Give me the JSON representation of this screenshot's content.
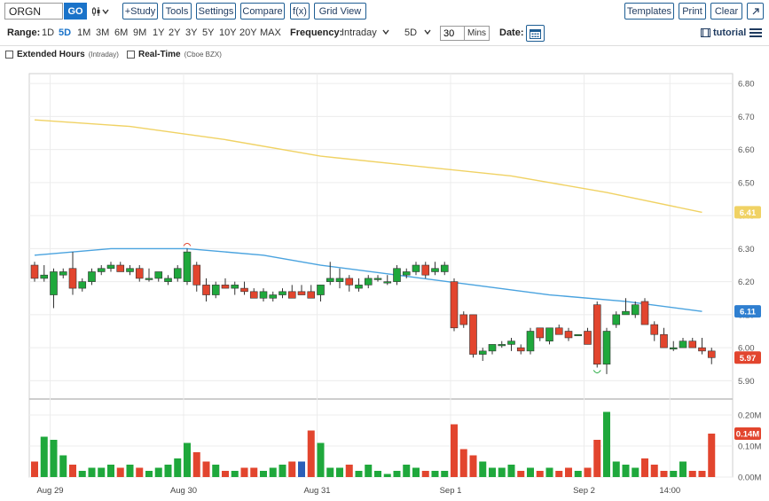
{
  "toolbar": {
    "symbol": "ORGN",
    "go_label": "GO",
    "chart_type_icon": "candlestick-icon",
    "buttons_left": [
      "+Study",
      "Tools",
      "Settings",
      "Compare",
      "f(x)",
      "Grid View"
    ],
    "buttons_right": [
      "Templates",
      "Print",
      "Clear"
    ],
    "expand_icon": "expand-icon"
  },
  "rangebar": {
    "range_label": "Range:",
    "ranges": [
      "1D",
      "5D",
      "1M",
      "3M",
      "6M",
      "9M",
      "1Y",
      "2Y",
      "3Y",
      "5Y",
      "10Y",
      "20Y",
      "MAX"
    ],
    "active_range": "5D",
    "frequency_label": "Frequency:",
    "frequency_value": "Intraday",
    "period_value": "5D",
    "minutes_value": "30",
    "minutes_unit": "Mins",
    "date_label": "Date:",
    "tutorial_label": "tutorial"
  },
  "options": {
    "extended_label": "Extended Hours",
    "extended_sub": "(Intraday)",
    "realtime_label": "Real-Time",
    "realtime_sub": "(Cboe BZX)"
  },
  "colors": {
    "up": "#1fa83c",
    "down": "#e2452e",
    "ma_fast": "#4aa3df",
    "ma_slow": "#f0d264",
    "vol_blue": "#2b5fb8"
  },
  "chart_data": {
    "type": "candlestick",
    "price_ylim": [
      5.85,
      6.83
    ],
    "price_ticks": [
      "6.80",
      "6.70",
      "6.60",
      "6.50",
      "6.40",
      "6.30",
      "6.20",
      "6.10",
      "6.00",
      "5.90"
    ],
    "volume_ylim": [
      0,
      0.24
    ],
    "volume_ticks": [
      "0.20M",
      "0.10M",
      "0.00M"
    ],
    "x_labels": [
      "Aug 29",
      "Aug 30",
      "Aug 31",
      "Sep 1",
      "Sep 2",
      "14:00"
    ],
    "badges": {
      "ma_slow": {
        "label": "6.41",
        "value": 6.41
      },
      "ma_fast": {
        "label": "6.11",
        "value": 6.11
      },
      "last": {
        "label": "5.97",
        "value": 5.97
      },
      "volume": {
        "label": "0.14M",
        "value": 0.14
      }
    },
    "candles": [
      {
        "o": 6.25,
        "h": 6.26,
        "l": 6.2,
        "c": 6.21
      },
      {
        "o": 6.21,
        "h": 6.25,
        "l": 6.2,
        "c": 6.22
      },
      {
        "o": 6.16,
        "h": 6.24,
        "l": 6.12,
        "c": 6.23
      },
      {
        "o": 6.22,
        "h": 6.24,
        "l": 6.21,
        "c": 6.23
      },
      {
        "o": 6.24,
        "h": 6.29,
        "l": 6.16,
        "c": 6.18
      },
      {
        "o": 6.18,
        "h": 6.21,
        "l": 6.17,
        "c": 6.2
      },
      {
        "o": 6.2,
        "h": 6.24,
        "l": 6.19,
        "c": 6.23
      },
      {
        "o": 6.23,
        "h": 6.25,
        "l": 6.22,
        "c": 6.24
      },
      {
        "o": 6.24,
        "h": 6.26,
        "l": 6.23,
        "c": 6.25
      },
      {
        "o": 6.25,
        "h": 6.26,
        "l": 6.23,
        "c": 6.23
      },
      {
        "o": 6.23,
        "h": 6.25,
        "l": 6.22,
        "c": 6.24
      },
      {
        "o": 6.24,
        "h": 6.25,
        "l": 6.2,
        "c": 6.21
      },
      {
        "o": 6.21,
        "h": 6.24,
        "l": 6.2,
        "c": 6.21
      },
      {
        "o": 6.21,
        "h": 6.23,
        "l": 6.2,
        "c": 6.23
      },
      {
        "o": 6.2,
        "h": 6.22,
        "l": 6.19,
        "c": 6.21
      },
      {
        "o": 6.21,
        "h": 6.25,
        "l": 6.2,
        "c": 6.24
      },
      {
        "o": 6.2,
        "h": 6.3,
        "l": 6.19,
        "c": 6.29
      },
      {
        "o": 6.25,
        "h": 6.26,
        "l": 6.17,
        "c": 6.19
      },
      {
        "o": 6.19,
        "h": 6.21,
        "l": 6.14,
        "c": 6.16
      },
      {
        "o": 6.16,
        "h": 6.2,
        "l": 6.15,
        "c": 6.19
      },
      {
        "o": 6.19,
        "h": 6.21,
        "l": 6.18,
        "c": 6.18
      },
      {
        "o": 6.18,
        "h": 6.2,
        "l": 6.16,
        "c": 6.19
      },
      {
        "o": 6.18,
        "h": 6.2,
        "l": 6.16,
        "c": 6.17
      },
      {
        "o": 6.17,
        "h": 6.18,
        "l": 6.15,
        "c": 6.15
      },
      {
        "o": 6.15,
        "h": 6.18,
        "l": 6.14,
        "c": 6.17
      },
      {
        "o": 6.15,
        "h": 6.17,
        "l": 6.14,
        "c": 6.16
      },
      {
        "o": 6.16,
        "h": 6.18,
        "l": 6.15,
        "c": 6.17
      },
      {
        "o": 6.17,
        "h": 6.19,
        "l": 6.15,
        "c": 6.15
      },
      {
        "o": 6.17,
        "h": 6.19,
        "l": 6.16,
        "c": 6.16
      },
      {
        "o": 6.17,
        "h": 6.19,
        "l": 6.15,
        "c": 6.15
      },
      {
        "o": 6.16,
        "h": 6.19,
        "l": 6.14,
        "c": 6.19
      },
      {
        "o": 6.2,
        "h": 6.26,
        "l": 6.19,
        "c": 6.21
      },
      {
        "o": 6.2,
        "h": 6.24,
        "l": 6.18,
        "c": 6.21
      },
      {
        "o": 6.21,
        "h": 6.22,
        "l": 6.17,
        "c": 6.19
      },
      {
        "o": 6.18,
        "h": 6.21,
        "l": 6.17,
        "c": 6.19
      },
      {
        "o": 6.19,
        "h": 6.22,
        "l": 6.18,
        "c": 6.21
      },
      {
        "o": 6.21,
        "h": 6.22,
        "l": 6.2,
        "c": 6.21
      },
      {
        "o": 6.2,
        "h": 6.22,
        "l": 6.19,
        "c": 6.2
      },
      {
        "o": 6.2,
        "h": 6.25,
        "l": 6.19,
        "c": 6.24
      },
      {
        "o": 6.22,
        "h": 6.24,
        "l": 6.21,
        "c": 6.23
      },
      {
        "o": 6.23,
        "h": 6.26,
        "l": 6.22,
        "c": 6.25
      },
      {
        "o": 6.25,
        "h": 6.26,
        "l": 6.21,
        "c": 6.22
      },
      {
        "o": 6.23,
        "h": 6.26,
        "l": 6.22,
        "c": 6.24
      },
      {
        "o": 6.23,
        "h": 6.26,
        "l": 6.22,
        "c": 6.25
      },
      {
        "o": 6.2,
        "h": 6.21,
        "l": 6.05,
        "c": 6.06
      },
      {
        "o": 6.1,
        "h": 6.11,
        "l": 6.06,
        "c": 6.07
      },
      {
        "o": 6.1,
        "h": 6.1,
        "l": 5.97,
        "c": 5.98
      },
      {
        "o": 5.98,
        "h": 6.0,
        "l": 5.96,
        "c": 5.99
      },
      {
        "o": 5.99,
        "h": 6.01,
        "l": 5.98,
        "c": 6.01
      },
      {
        "o": 6.01,
        "h": 6.02,
        "l": 6.0,
        "c": 6.01
      },
      {
        "o": 6.01,
        "h": 6.03,
        "l": 5.99,
        "c": 6.02
      },
      {
        "o": 6.0,
        "h": 6.01,
        "l": 5.98,
        "c": 5.99
      },
      {
        "o": 5.99,
        "h": 6.06,
        "l": 5.98,
        "c": 6.05
      },
      {
        "o": 6.06,
        "h": 6.06,
        "l": 6.02,
        "c": 6.03
      },
      {
        "o": 6.02,
        "h": 6.06,
        "l": 6.01,
        "c": 6.06
      },
      {
        "o": 6.06,
        "h": 6.07,
        "l": 6.04,
        "c": 6.04
      },
      {
        "o": 6.05,
        "h": 6.06,
        "l": 6.02,
        "c": 6.03
      },
      {
        "o": 6.04,
        "h": 6.04,
        "l": 6.04,
        "c": 6.04
      },
      {
        "o": 6.05,
        "h": 6.06,
        "l": 6.01,
        "c": 6.01
      },
      {
        "o": 6.13,
        "h": 6.14,
        "l": 5.94,
        "c": 5.95
      },
      {
        "o": 5.95,
        "h": 6.06,
        "l": 5.92,
        "c": 6.05
      },
      {
        "o": 6.07,
        "h": 6.11,
        "l": 6.06,
        "c": 6.1
      },
      {
        "o": 6.1,
        "h": 6.15,
        "l": 6.1,
        "c": 6.11
      },
      {
        "o": 6.1,
        "h": 6.14,
        "l": 6.09,
        "c": 6.13
      },
      {
        "o": 6.14,
        "h": 6.15,
        "l": 6.07,
        "c": 6.07
      },
      {
        "o": 6.07,
        "h": 6.08,
        "l": 6.02,
        "c": 6.04
      },
      {
        "o": 6.04,
        "h": 6.06,
        "l": 6.0,
        "c": 6.0
      },
      {
        "o": 6.0,
        "h": 6.02,
        "l": 5.99,
        "c": 6.0
      },
      {
        "o": 6.0,
        "h": 6.03,
        "l": 6.0,
        "c": 6.02
      },
      {
        "o": 6.02,
        "h": 6.03,
        "l": 6.0,
        "c": 6.0
      },
      {
        "o": 6.0,
        "h": 6.03,
        "l": 5.98,
        "c": 5.99
      },
      {
        "o": 5.99,
        "h": 6.0,
        "l": 5.95,
        "c": 5.97
      }
    ],
    "volume": [
      0.05,
      0.13,
      0.12,
      0.07,
      0.04,
      0.02,
      0.03,
      0.03,
      0.04,
      0.03,
      0.04,
      0.03,
      0.02,
      0.03,
      0.04,
      0.06,
      0.11,
      0.08,
      0.05,
      0.04,
      0.02,
      0.02,
      0.03,
      0.03,
      0.02,
      0.03,
      0.04,
      0.05,
      0.05,
      0.15,
      0.11,
      0.03,
      0.03,
      0.04,
      0.02,
      0.04,
      0.02,
      0.01,
      0.02,
      0.04,
      0.03,
      0.02,
      0.02,
      0.02,
      0.17,
      0.09,
      0.07,
      0.05,
      0.03,
      0.03,
      0.04,
      0.02,
      0.03,
      0.02,
      0.03,
      0.02,
      0.03,
      0.02,
      0.03,
      0.12,
      0.21,
      0.05,
      0.04,
      0.03,
      0.06,
      0.04,
      0.02,
      0.02,
      0.05,
      0.02,
      0.02,
      0.14
    ],
    "volume_highlight_indices": [
      28
    ],
    "ma_slow": [
      [
        0,
        6.69
      ],
      [
        10,
        6.67
      ],
      [
        20,
        6.63
      ],
      [
        30,
        6.58
      ],
      [
        40,
        6.55
      ],
      [
        50,
        6.52
      ],
      [
        60,
        6.47
      ],
      [
        70,
        6.41
      ]
    ],
    "ma_fast": [
      [
        0,
        6.28
      ],
      [
        8,
        6.3
      ],
      [
        16,
        6.3
      ],
      [
        24,
        6.28
      ],
      [
        30,
        6.25
      ],
      [
        38,
        6.22
      ],
      [
        46,
        6.19
      ],
      [
        54,
        6.16
      ],
      [
        62,
        6.14
      ],
      [
        70,
        6.11
      ]
    ],
    "markers": [
      {
        "index": 16,
        "at": "high"
      },
      {
        "index": 59,
        "at": "low"
      }
    ]
  }
}
